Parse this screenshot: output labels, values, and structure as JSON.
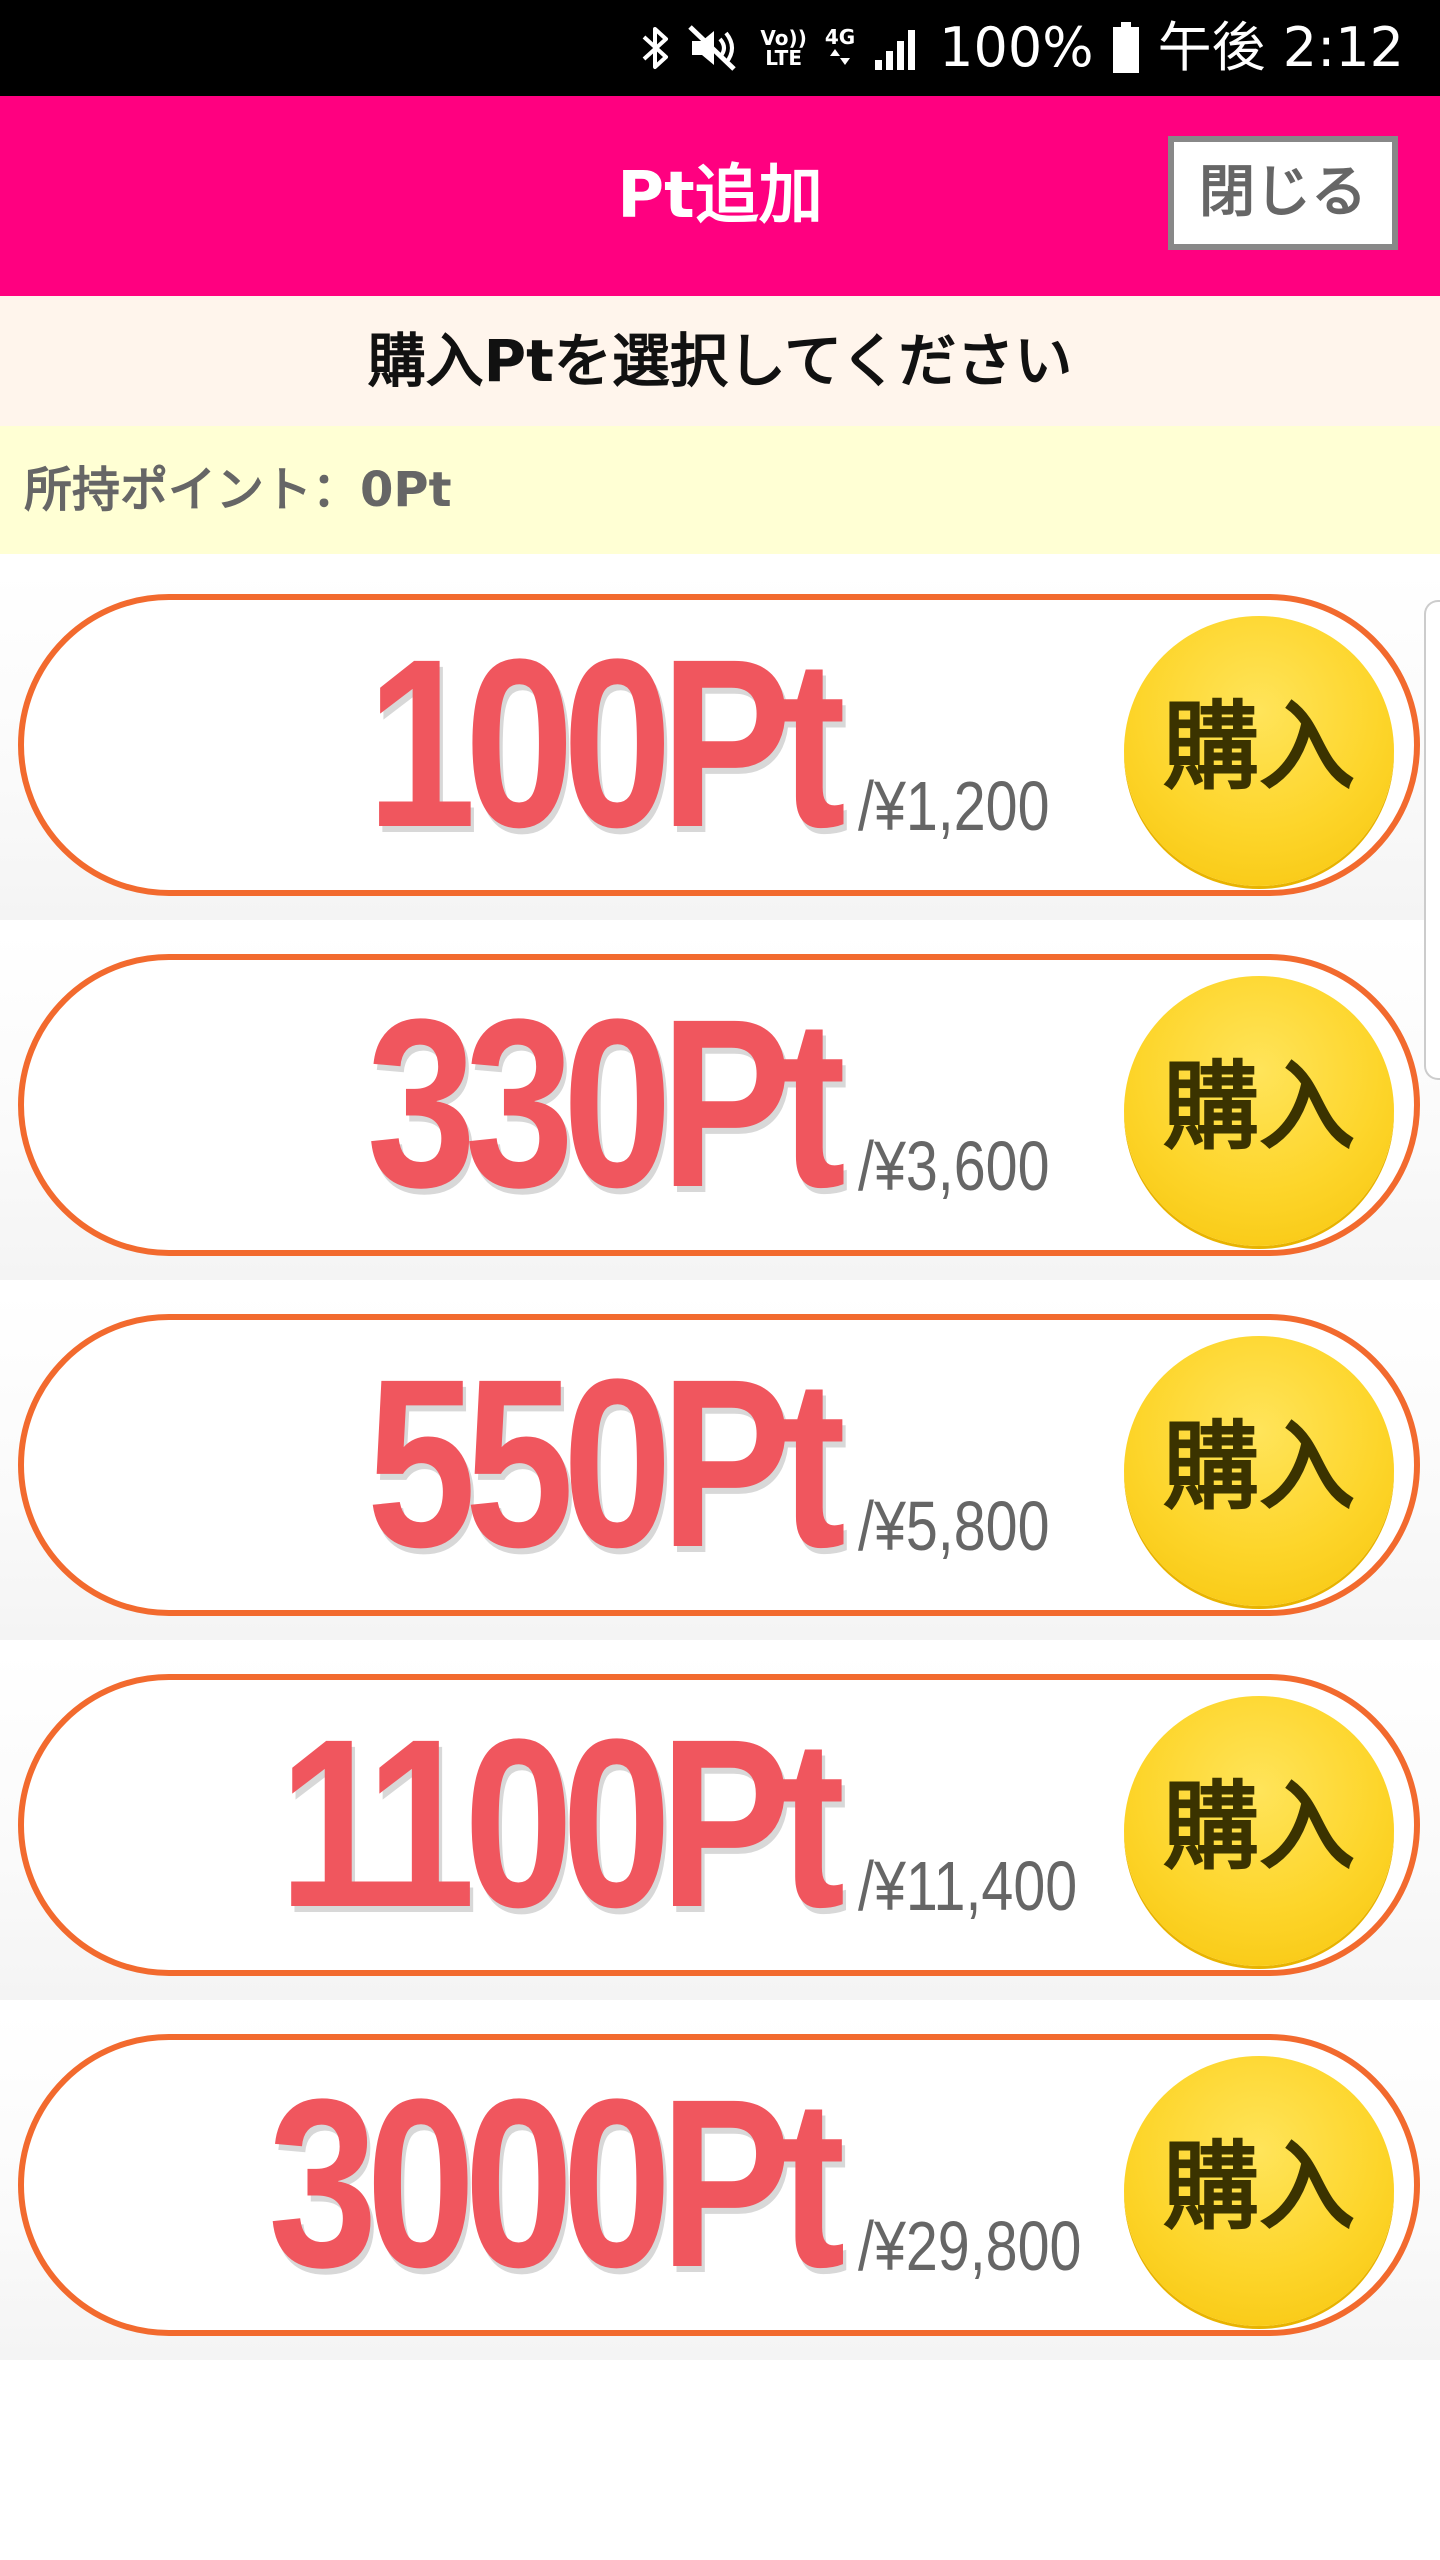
{
  "status_bar": {
    "volte_top": "Vo))",
    "volte_bottom": "LTE",
    "network": "4G",
    "battery_percent": "100%",
    "time": "午後 2:12"
  },
  "header": {
    "title": "Pt追加",
    "close_label": "閉じる"
  },
  "instruction": "購入Ptを選択してください",
  "points": {
    "label": "所持ポイント：0Pt"
  },
  "options": [
    {
      "points": "100Pt",
      "price": "/¥1,200",
      "buy_label": "購入"
    },
    {
      "points": "330Pt",
      "price": "/¥3,600",
      "buy_label": "購入"
    },
    {
      "points": "550Pt",
      "price": "/¥5,800",
      "buy_label": "購入"
    },
    {
      "points": "1100Pt",
      "price": "/¥11,400",
      "buy_label": "購入"
    },
    {
      "points": "3000Pt",
      "price": "/¥29,800",
      "buy_label": "購入"
    }
  ],
  "colors": {
    "header_bg": "#ff0080",
    "instruction_bg": "#fff5ec",
    "points_bg": "#ffffd4",
    "pill_border": "#f26a2e",
    "amount_text": "#f0565e",
    "buy_button": "#fdd52a"
  },
  "icons": {
    "bluetooth": "bluetooth-icon",
    "mute": "mute-icon",
    "signal": "signal-icon",
    "battery": "battery-icon"
  }
}
